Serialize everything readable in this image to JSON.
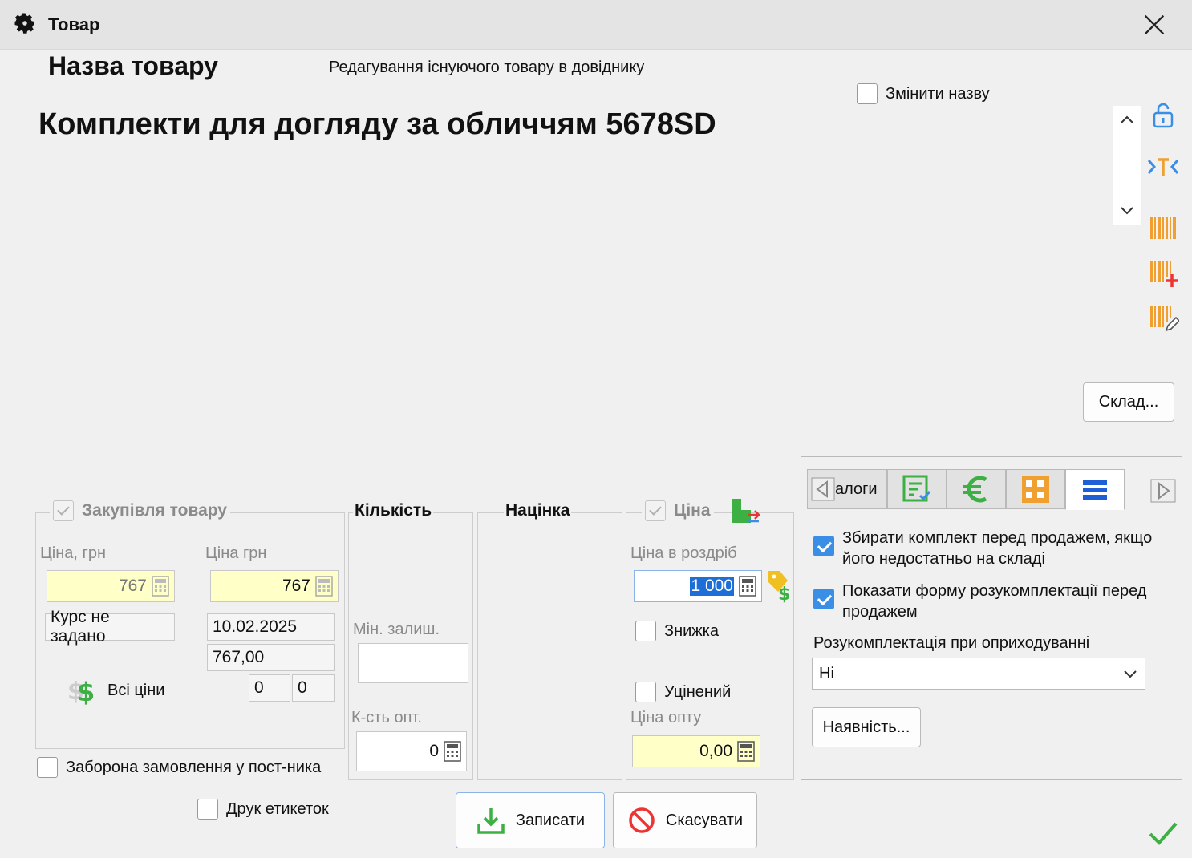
{
  "window": {
    "title": "Товар",
    "icons": {
      "window": "gear-icon",
      "close": "close-icon"
    }
  },
  "header": {
    "name_label": "Назва товару",
    "subtitle": "Редагування існуючого товару в довіднику",
    "change_name_label": "Змінити назву",
    "product_name": "Комплекти для догляду за обличчям 5678SD"
  },
  "sidebar": {
    "icons": [
      "lock-open-icon",
      "text-cursor-icon",
      "barcode-icon",
      "barcode-add-icon",
      "barcode-edit-icon"
    ],
    "warehouse_button": "Склад..."
  },
  "purchase": {
    "title": "Закупівля товару",
    "price_uah_label": "Ціна, грн",
    "price_uah": "767",
    "price_grn_label": "Ціна грн",
    "price_grn": "767",
    "rate": "Курс не задано",
    "date": "10.02.2025",
    "amount": "767,00",
    "all_prices": "Всі ціни",
    "field_a": "0",
    "field_b": "0"
  },
  "quantity": {
    "title": "Кількість",
    "min_stock_label": "Мін. залиш.",
    "min_stock": "",
    "wholesale_qty_label": "К-сть опт.",
    "wholesale_qty": "0"
  },
  "markup": {
    "title": "Націнка"
  },
  "price": {
    "title": "Ціна",
    "retail_label": "Ціна в роздріб",
    "retail": "1 000",
    "discount_label": "Знижка",
    "discounted_label": "Уцінений",
    "wholesale_label": "Ціна опту",
    "wholesale": "0,00"
  },
  "checkboxes": {
    "order_ban": "Заборона замовлення у пост-ника",
    "print_labels": "Друк етикеток"
  },
  "actions": {
    "save": "Записати",
    "cancel": "Скасувати"
  },
  "tabs": {
    "first_label": "алоги",
    "icons": [
      "left-arrow-icon",
      "document-check-icon",
      "euro-icon",
      "grid-icon",
      "list-icon",
      "right-arrow-icon"
    ],
    "assemble_label": "Збирати комплект перед продажем, якщо його недостатньо на складі",
    "disassemble_form_label": "Показати форму розукомплектації перед продажем",
    "disassembly_label": "Розукомплектація при оприходуванні",
    "disassembly_value": "Ні",
    "availability_button": "Наявність..."
  },
  "colors": {
    "accent": "#3a8ee6",
    "barcode": "#f0a030",
    "green": "#3cb043",
    "yellow_field": "#ffffc8"
  }
}
